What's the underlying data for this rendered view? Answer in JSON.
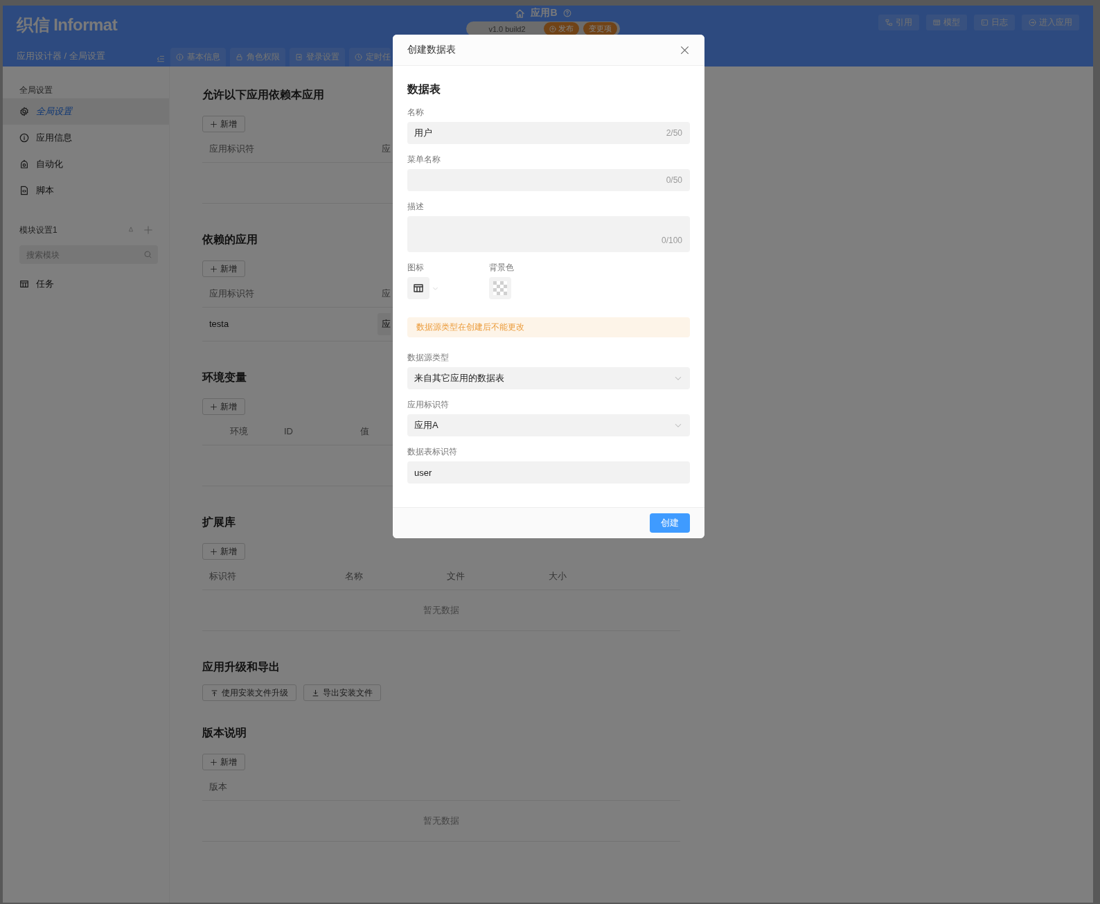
{
  "header": {
    "logo": "织信 Informat",
    "breadcrumb": "应用设计器 / 全局设置",
    "app_name": "应用B",
    "version": "v1.0 build2",
    "publish_label": "发布",
    "changes_label": "变更项",
    "tabs": [
      {
        "label": "基本信息",
        "selected": false
      },
      {
        "label": "角色权限",
        "selected": false
      },
      {
        "label": "登录设置",
        "selected": false
      },
      {
        "label": "定时任",
        "selected": false
      }
    ],
    "actions": [
      {
        "label": "引用"
      },
      {
        "label": "模型"
      },
      {
        "label": "日志"
      },
      {
        "label": "进入应用"
      }
    ]
  },
  "sidebar": {
    "section_title": "全局设置",
    "items": [
      {
        "label": "全局设置",
        "selected": true
      },
      {
        "label": "应用信息",
        "selected": false
      },
      {
        "label": "自动化",
        "selected": false
      },
      {
        "label": "脚本",
        "selected": false
      }
    ],
    "module_title": "模块设置1",
    "search": {
      "placeholder": "搜索模块"
    },
    "module_items": [
      {
        "label": "任务",
        "selected": false
      }
    ]
  },
  "sections": [
    {
      "kind": "table",
      "title": "允许以下应用依赖本应用",
      "add_button": "新增",
      "columns": [
        "应用标识符",
        "应"
      ]
    },
    {
      "kind": "table",
      "title": "依赖的应用",
      "add_button": "新增",
      "columns": [
        "应用标识符",
        "应"
      ],
      "rows": [
        {
          "identifier": "testa",
          "column_2": "应"
        }
      ]
    },
    {
      "kind": "table",
      "title": "环境变量",
      "add_button": "新增",
      "columns": [
        "环境",
        "ID",
        "值"
      ]
    },
    {
      "kind": "table",
      "title": "扩展库",
      "add_button": "新增",
      "columns": [
        "标识符",
        "名称",
        "文件",
        "大小"
      ],
      "empty_text": "暂无数据"
    },
    {
      "kind": "buttons",
      "title": "应用升级和导出",
      "buttons": [
        {
          "label": "使用安装文件升级"
        },
        {
          "label": "导出安装文件"
        }
      ]
    },
    {
      "kind": "table",
      "title": "版本说明",
      "add_button": "新增",
      "columns": [
        "版本"
      ],
      "empty_text": "暂无数据"
    }
  ],
  "dialog": {
    "title": "创建数据表",
    "heading": "数据表",
    "fields_top": [
      {
        "kind": "input",
        "label": "名称",
        "value": "用户",
        "counter": "2/50"
      },
      {
        "kind": "input",
        "label": "菜单名称",
        "counter": "0/50"
      },
      {
        "kind": "textarea",
        "label": "描述",
        "counter": "0/100"
      }
    ],
    "icon_label": "图标",
    "color_label": "背景色",
    "alert": "数据源类型在创建后不能更改",
    "fields_bottom": [
      {
        "kind": "select",
        "label": "数据源类型",
        "value": "来自其它应用的数据表"
      },
      {
        "kind": "select",
        "label": "应用标识符",
        "value": "应用A"
      },
      {
        "kind": "input",
        "label": "数据表标识符",
        "value": "user"
      }
    ],
    "submit_button": "创建"
  }
}
